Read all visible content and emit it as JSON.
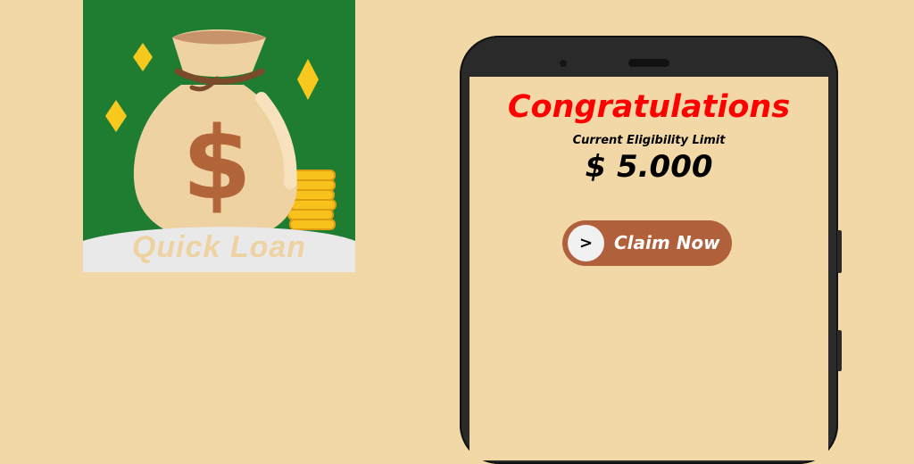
{
  "app_icon": {
    "label": "Quick Loan",
    "icon": "money-bag-icon",
    "colors": {
      "background": "#1f7d32",
      "bag": "#efd2a2",
      "dollar": "#b3653a",
      "coins": "#f7c21b"
    }
  },
  "screen": {
    "headline": "Congratulations",
    "subtitle": "Current Eligibility Limit",
    "amount": "$ 5.000",
    "claim_button": {
      "arrow": ">",
      "label": "Claim Now"
    }
  },
  "colors": {
    "page_background": "#f3d8a7",
    "headline": "#ff0000",
    "button": "#b0603a"
  }
}
